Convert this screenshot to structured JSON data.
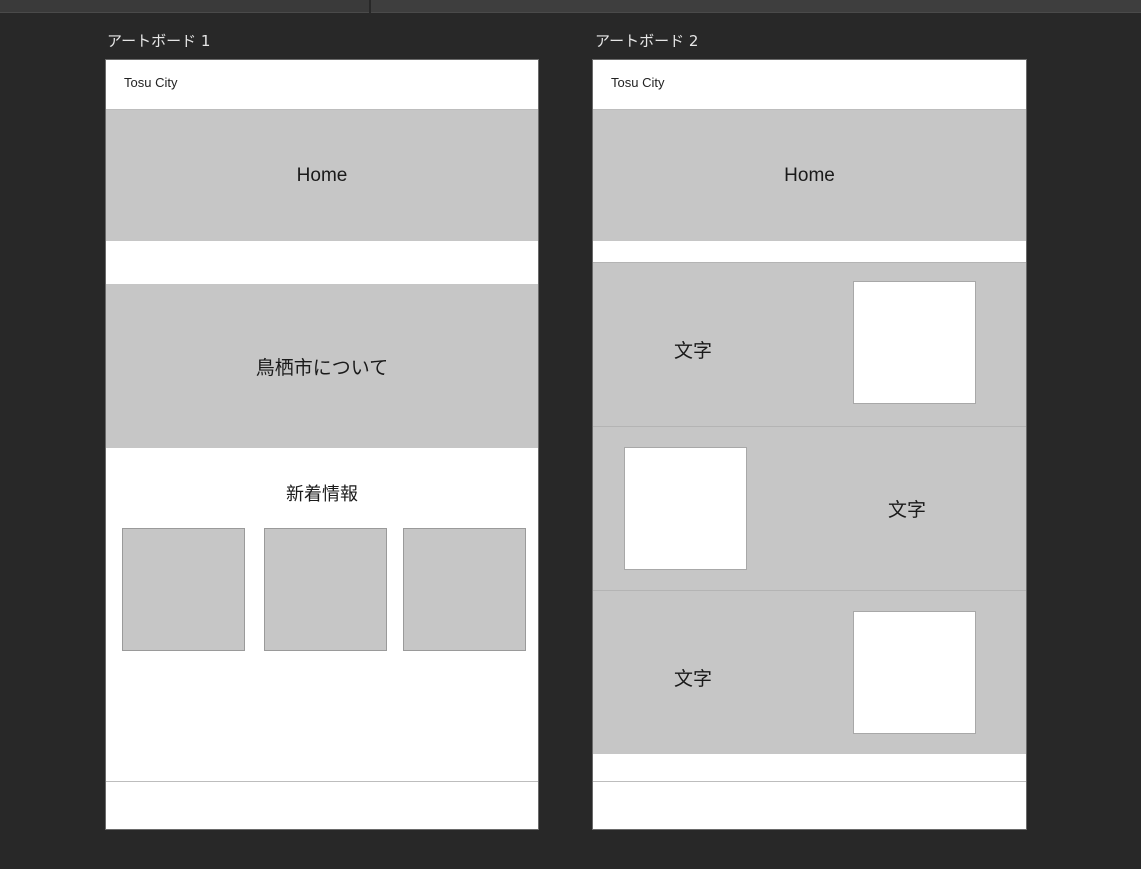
{
  "artboards": [
    {
      "title": "アートボード 1",
      "logo": "Tosu City",
      "hero": "Home",
      "about": "鳥栖市について",
      "news_title": "新着情報",
      "news_cards": 3
    },
    {
      "title": "アートボード 2",
      "logo": "Tosu City",
      "hero": "Home",
      "rows": [
        {
          "text": "文字",
          "image_side": "right"
        },
        {
          "text": "文字",
          "image_side": "left"
        },
        {
          "text": "文字",
          "image_side": "right"
        }
      ]
    }
  ],
  "colors": {
    "canvas": "#282828",
    "placeholder_gray": "#c6c6c6",
    "artboard": "#ffffff"
  }
}
